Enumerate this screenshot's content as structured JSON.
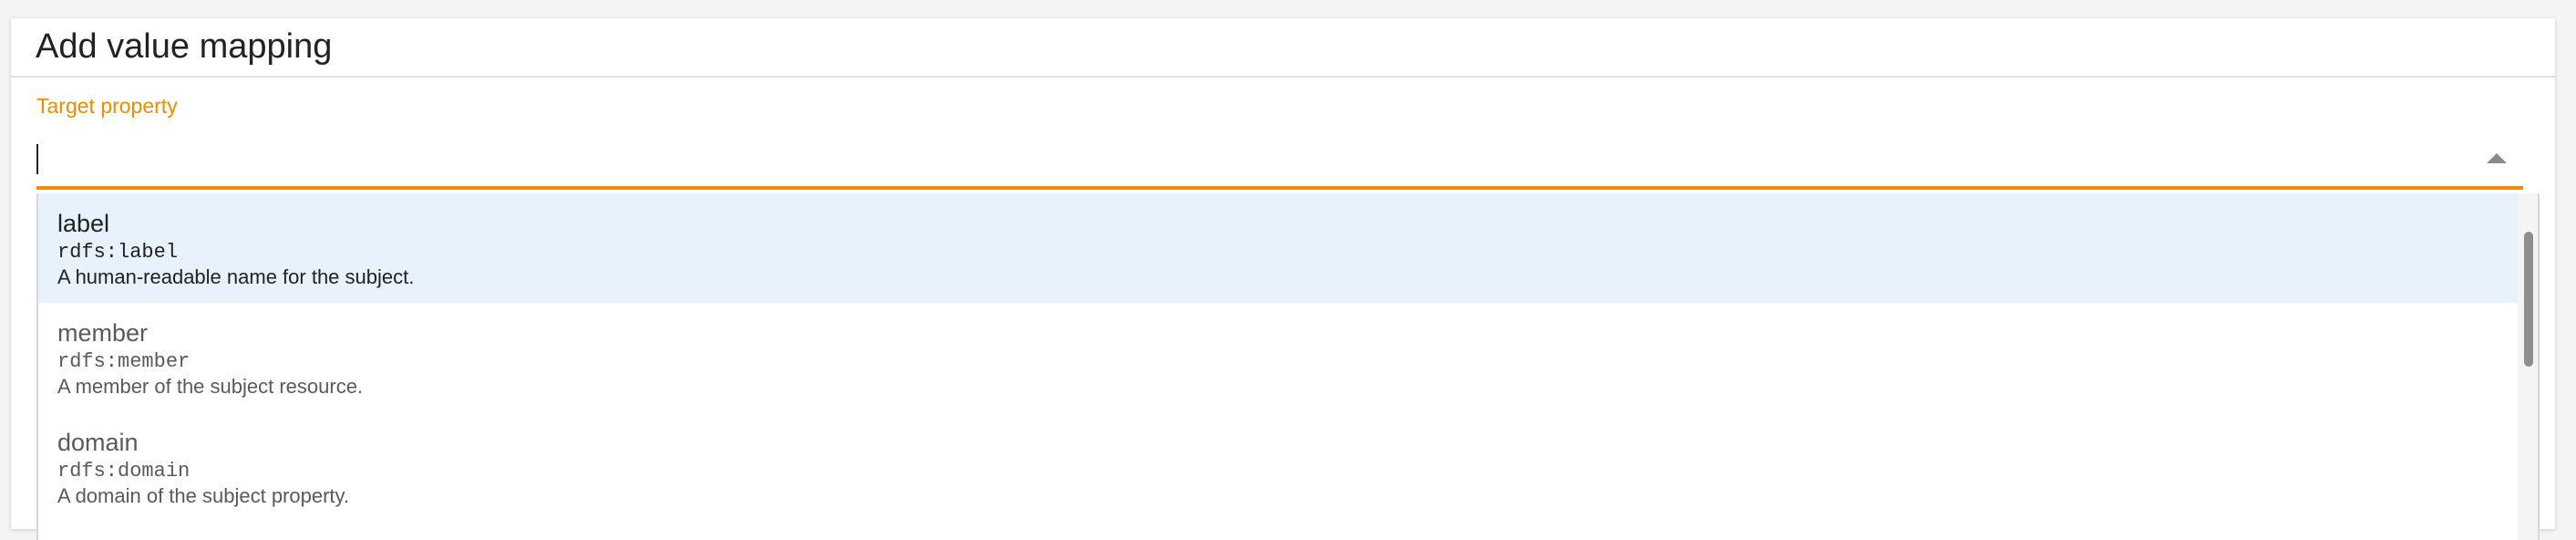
{
  "dialog": {
    "title": "Add value mapping"
  },
  "field": {
    "label": "Target property",
    "value": ""
  },
  "options": [
    {
      "title": "label",
      "uri": "rdfs:label",
      "description": "A human-readable name for the subject.",
      "highlighted": true
    },
    {
      "title": "member",
      "uri": "rdfs:member",
      "description": "A member of the subject resource.",
      "highlighted": false
    },
    {
      "title": "domain",
      "uri": "rdfs:domain",
      "description": "A domain of the subject property.",
      "highlighted": false
    }
  ],
  "colors": {
    "accent": "#f08c00",
    "highlight": "#e8f2fd"
  },
  "icons": {
    "dropdown_toggle": "caret-up-icon"
  }
}
